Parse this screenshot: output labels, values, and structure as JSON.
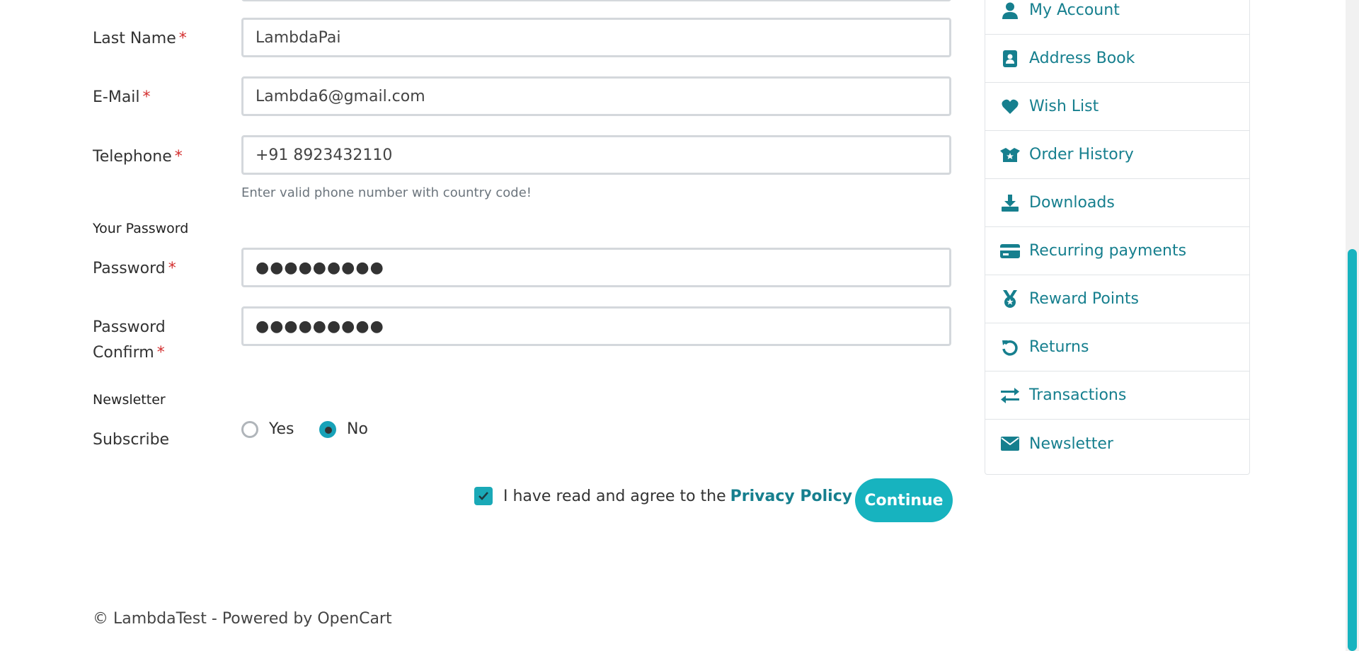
{
  "form": {
    "last_name_label": "Last Name",
    "last_name_value": "LambdaPai",
    "email_label": "E-Mail",
    "email_value": "Lambda6@gmail.com",
    "telephone_label": "Telephone",
    "telephone_value": "+91 8923432110",
    "telephone_help": "Enter valid phone number with country code!",
    "required_mark": "*",
    "password_section": "Your Password",
    "password_label": "Password",
    "password_value": "●●●●●●●●●",
    "password_confirm_label_line1": "Password",
    "password_confirm_label_line2": "Confirm",
    "password_confirm_value": "●●●●●●●●●",
    "newsletter_section": "Newsletter",
    "subscribe_label": "Subscribe",
    "subscribe_yes": "Yes",
    "subscribe_no": "No",
    "subscribe_selected": "No",
    "agree_text": "I have read and agree to the",
    "privacy_link": "Privacy Policy",
    "continue_label": "Continue"
  },
  "sidebar": {
    "items": [
      {
        "label": "My Account",
        "icon": "user-icon"
      },
      {
        "label": "Address Book",
        "icon": "address-book-icon"
      },
      {
        "label": "Wish List",
        "icon": "heart-icon"
      },
      {
        "label": "Order History",
        "icon": "box-open-icon"
      },
      {
        "label": "Downloads",
        "icon": "download-icon"
      },
      {
        "label": "Recurring payments",
        "icon": "credit-card-icon"
      },
      {
        "label": "Reward Points",
        "icon": "medal-icon"
      },
      {
        "label": "Returns",
        "icon": "undo-icon"
      },
      {
        "label": "Transactions",
        "icon": "exchange-icon"
      },
      {
        "label": "Newsletter",
        "icon": "envelope-icon"
      }
    ]
  },
  "footer": {
    "text": "© LambdaTest - Powered by OpenCart"
  },
  "colors": {
    "accent": "#17b3bf",
    "link": "#167f8e",
    "required": "#d32f2f"
  }
}
